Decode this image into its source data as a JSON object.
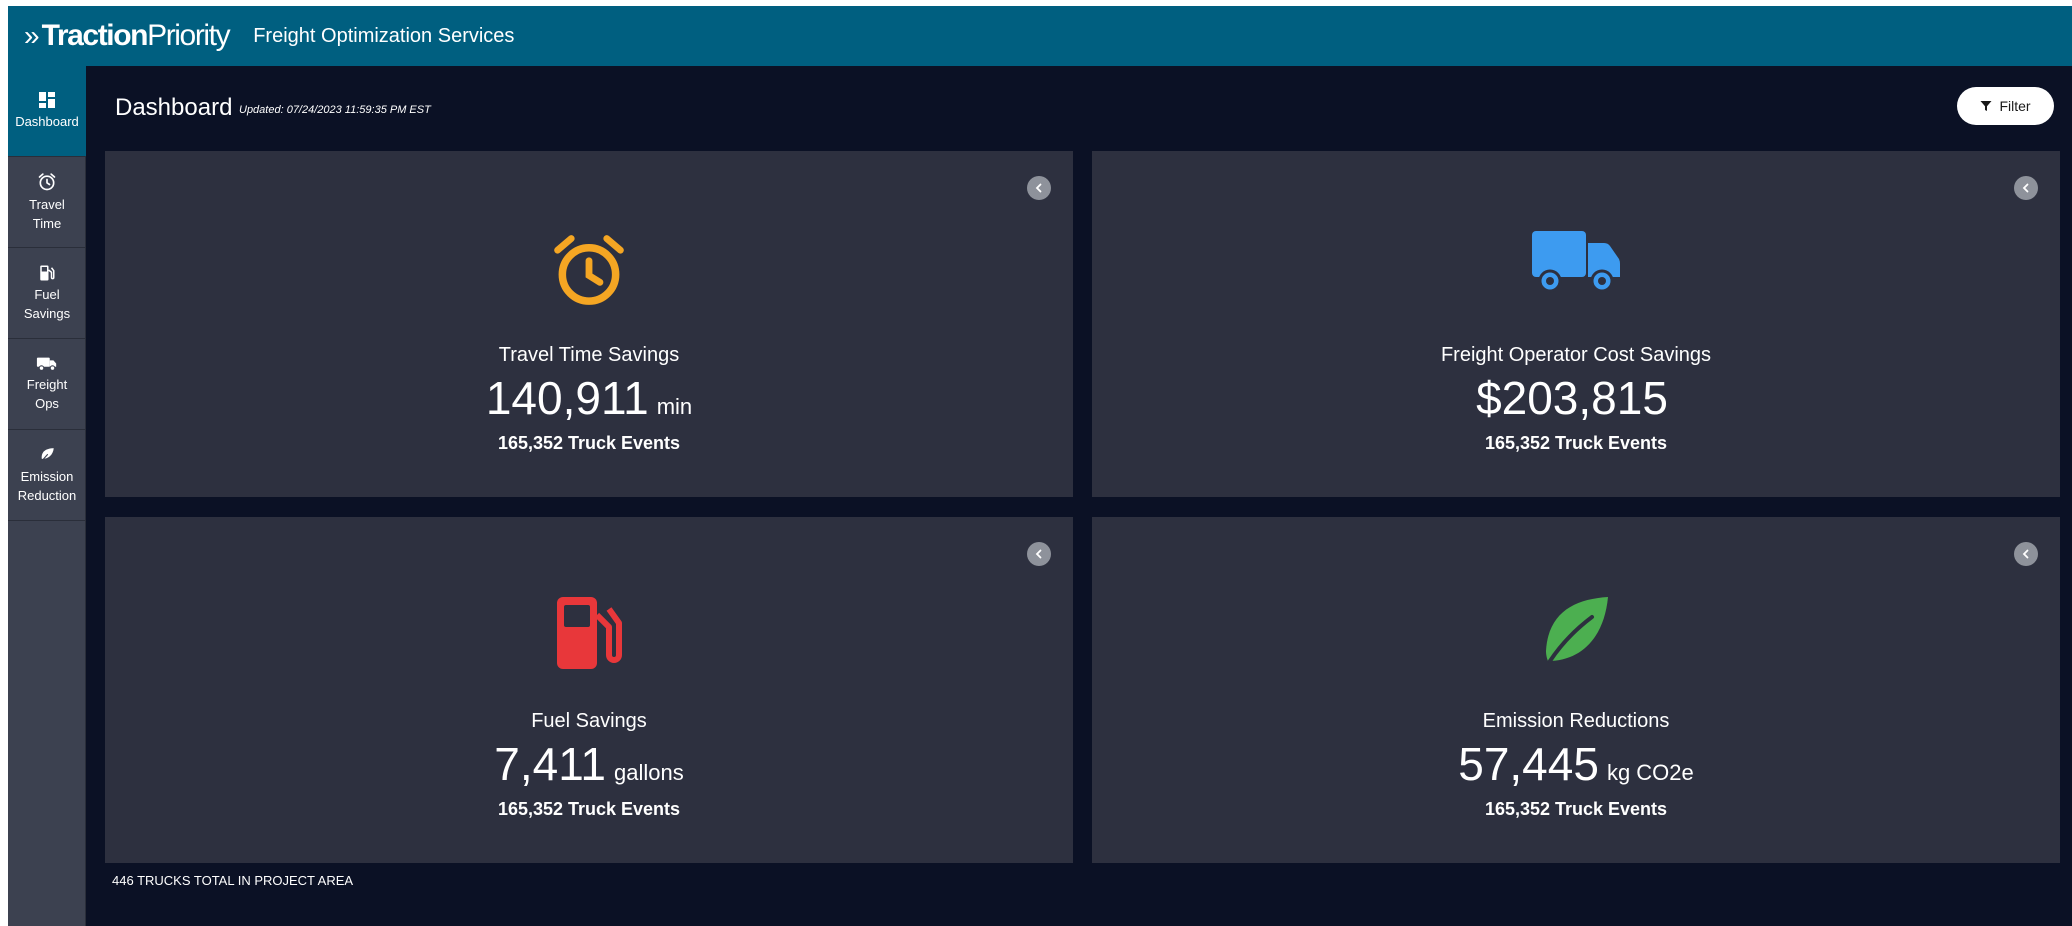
{
  "header": {
    "brand_part1": "Traction",
    "brand_part2": "Priority",
    "subtitle": "Freight Optimization Services"
  },
  "sidebar": {
    "items": [
      {
        "label": "Dashboard",
        "icon": "dashboard-icon",
        "active": true
      },
      {
        "label": "Travel\nTime",
        "icon": "alarm-clock-icon",
        "active": false
      },
      {
        "label": "Fuel\nSavings",
        "icon": "fuel-pump-icon",
        "active": false
      },
      {
        "label": "Freight\nOps",
        "icon": "truck-icon",
        "active": false
      },
      {
        "label": "Emission\nReduction",
        "icon": "leaf-icon",
        "active": false
      }
    ]
  },
  "page": {
    "title": "Dashboard",
    "updated": "Updated: 07/24/2023 11:59:35 PM EST",
    "filter_label": "Filter",
    "footer_note": "446 TRUCKS TOTAL IN PROJECT AREA"
  },
  "cards": [
    {
      "title": "Travel Time Savings",
      "value": "140,911",
      "unit": "min",
      "events": "165,352 Truck Events",
      "icon": "alarm-clock-icon",
      "icon_color": "#f5a623"
    },
    {
      "title": "Freight Operator Cost Savings",
      "value": "$203,815",
      "unit": "",
      "events": "165,352 Truck Events",
      "icon": "truck-icon",
      "icon_color": "#3d9bf0"
    },
    {
      "title": "Fuel Savings",
      "value": "7,411",
      "unit": "gallons",
      "events": "165,352 Truck Events",
      "icon": "fuel-pump-icon",
      "icon_color": "#e8373a"
    },
    {
      "title": "Emission Reductions",
      "value": "57,445",
      "unit": "kg CO2e",
      "events": "165,352 Truck Events",
      "icon": "leaf-icon",
      "icon_color": "#4caf50"
    }
  ],
  "colors": {
    "topbar": "#005f80",
    "background": "#0b1125",
    "card": "#2d303f",
    "sidebar": "#3c4150"
  }
}
